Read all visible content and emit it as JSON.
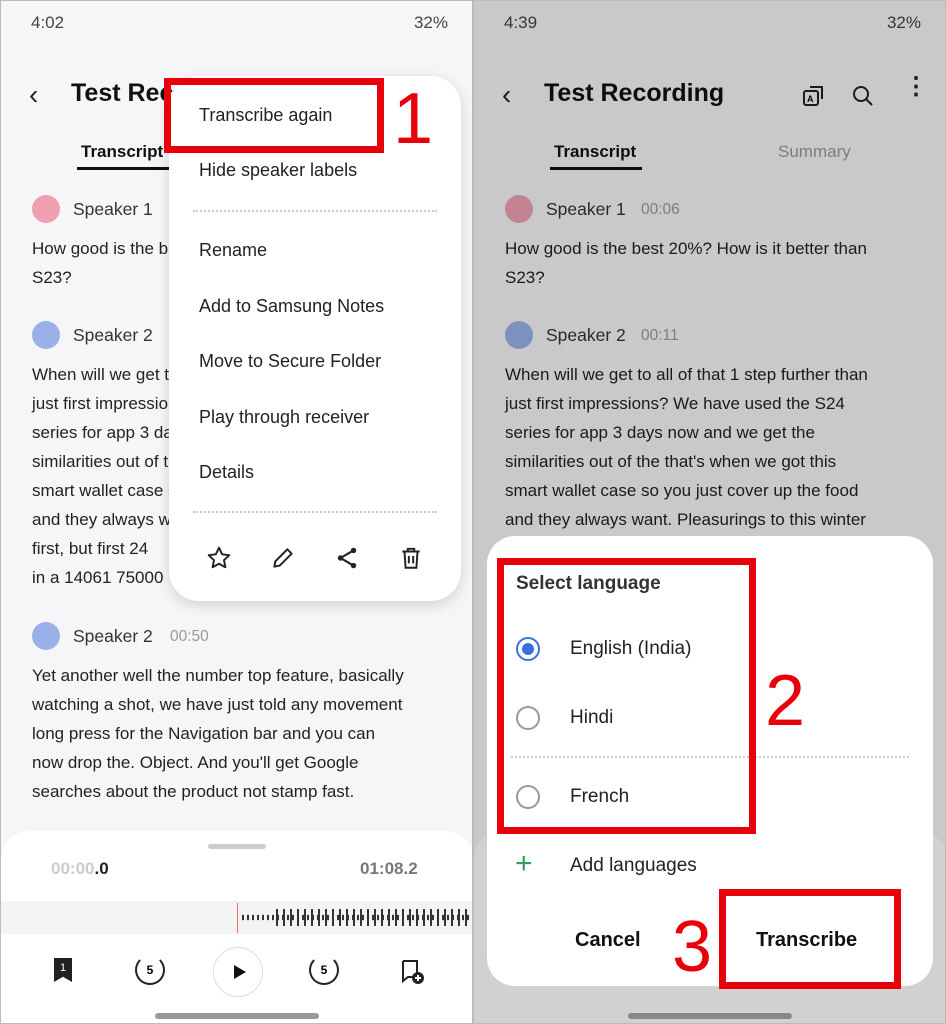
{
  "left": {
    "status": {
      "time": "4:02",
      "battery": "32%"
    },
    "title": "Test Recording",
    "tabs": [
      "Transcript"
    ],
    "segments": [
      {
        "speaker": "Speaker 1",
        "lines": [
          "How good is the best 20%? How is it better than",
          "S23?"
        ]
      },
      {
        "speaker": "Speaker 2",
        "lines": [
          "When will we get to all of that 1 step further than",
          "just first impressions? We have used the S24",
          "series for app 3 days now and we get the",
          "similarities out of the that's when we got this",
          "smart wallet case so you just cover up the food",
          "and they always want. Pleasurings to this winter",
          "first, but first 24",
          "in a 14061 75000"
        ]
      },
      {
        "speaker": "Speaker 2",
        "time": "00:50",
        "lines": [
          "Yet another well the number top feature, basically",
          "watching a shot, we have just told any movement",
          "long press for the Navigation bar and you can",
          "now drop the. Object. And you'll get Google",
          "searches about the product not stamp fast."
        ]
      }
    ],
    "menu": [
      "Transcribe again",
      "Hide speaker labels",
      "Rename",
      "Add to Samsung Notes",
      "Move to Secure Folder",
      "Play through receiver",
      "Details"
    ],
    "menu_icons": [
      "star-icon",
      "pencil-icon",
      "share-icon",
      "trash-icon"
    ],
    "player": {
      "elapsed_dim": "00:00",
      "elapsed": ".0",
      "total": "01:08.2",
      "bookmark_count": "1",
      "skip_back": "5",
      "skip_fwd": "5"
    },
    "annotation": "1"
  },
  "right": {
    "status": {
      "time": "4:39",
      "battery": "32%"
    },
    "title": "Test Recording",
    "tabs": [
      "Transcript",
      "Summary"
    ],
    "segments": [
      {
        "speaker": "Speaker 1",
        "time": "00:06",
        "lines": [
          "How good is the best 20%? How is it better than",
          "S23?"
        ]
      },
      {
        "speaker": "Speaker 2",
        "time": "00:11",
        "lines": [
          "When will we get to all of that 1 step further than",
          "just first impressions? We have used the S24",
          "series for app 3 days now and we get the",
          "similarities out of the that's when we got this",
          "smart wallet case so you just cover up the food",
          "and they always want. Pleasurings to this winter"
        ]
      }
    ],
    "dialog": {
      "title": "Select language",
      "options": [
        {
          "label": "English (India)",
          "selected": true
        },
        {
          "label": "Hindi",
          "selected": false
        },
        {
          "label": "French",
          "selected": false
        }
      ],
      "add": "Add languages",
      "cancel": "Cancel",
      "confirm": "Transcribe"
    },
    "annotations": [
      "2",
      "3"
    ]
  },
  "colors": {
    "accent": "#3b6fe0",
    "annotation": "#e8000b",
    "speaker1": "#f0a0b0",
    "speaker2": "#9ab0e8",
    "add": "#2e9e5a"
  }
}
